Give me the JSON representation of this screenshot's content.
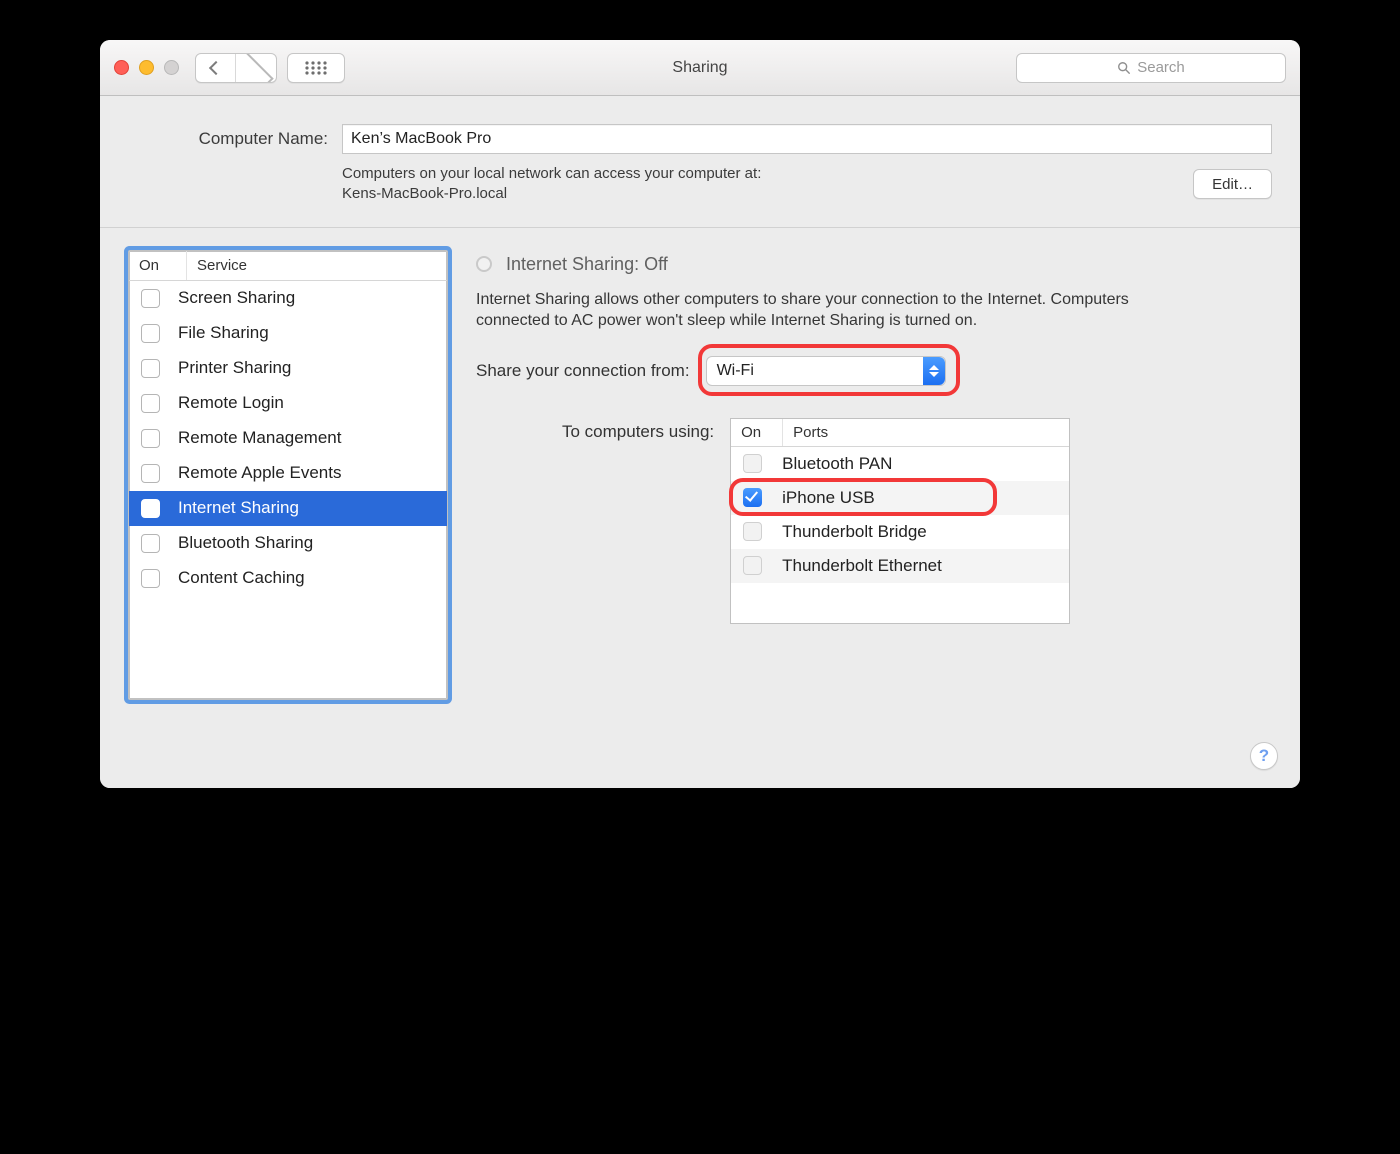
{
  "window": {
    "title": "Sharing"
  },
  "toolbar": {
    "search_placeholder": "Search"
  },
  "computer_name": {
    "label": "Computer Name:",
    "value": "Ken’s MacBook Pro",
    "description_line1": "Computers on your local network can access your computer at:",
    "description_line2": "Kens-MacBook-Pro.local",
    "edit_label": "Edit…"
  },
  "service_table": {
    "header_on": "On",
    "header_service": "Service",
    "rows": [
      {
        "on": false,
        "name": "Screen Sharing",
        "selected": false
      },
      {
        "on": false,
        "name": "File Sharing",
        "selected": false
      },
      {
        "on": false,
        "name": "Printer Sharing",
        "selected": false
      },
      {
        "on": false,
        "name": "Remote Login",
        "selected": false
      },
      {
        "on": false,
        "name": "Remote Management",
        "selected": false
      },
      {
        "on": false,
        "name": "Remote Apple Events",
        "selected": false
      },
      {
        "on": false,
        "name": "Internet Sharing",
        "selected": true
      },
      {
        "on": false,
        "name": "Bluetooth Sharing",
        "selected": false
      },
      {
        "on": false,
        "name": "Content Caching",
        "selected": false
      }
    ]
  },
  "detail": {
    "status_title": "Internet Sharing: Off",
    "description": "Internet Sharing allows other computers to share your connection to the Internet. Computers connected to AC power won't sleep while Internet Sharing is turned on.",
    "share_from_label": "Share your connection from:",
    "share_from_value": "Wi-Fi",
    "to_using_label": "To computers using:",
    "ports_header_on": "On",
    "ports_header_ports": "Ports",
    "ports": [
      {
        "on": false,
        "name": "Bluetooth PAN",
        "highlighted": false
      },
      {
        "on": true,
        "name": "iPhone USB",
        "highlighted": true
      },
      {
        "on": false,
        "name": "Thunderbolt Bridge",
        "highlighted": false
      },
      {
        "on": false,
        "name": "Thunderbolt Ethernet",
        "highlighted": false
      }
    ]
  },
  "help_label": "?",
  "colors": {
    "selection": "#2a6ad9",
    "accent_blue": "#1c6ff1",
    "callout_red": "#f23838"
  }
}
